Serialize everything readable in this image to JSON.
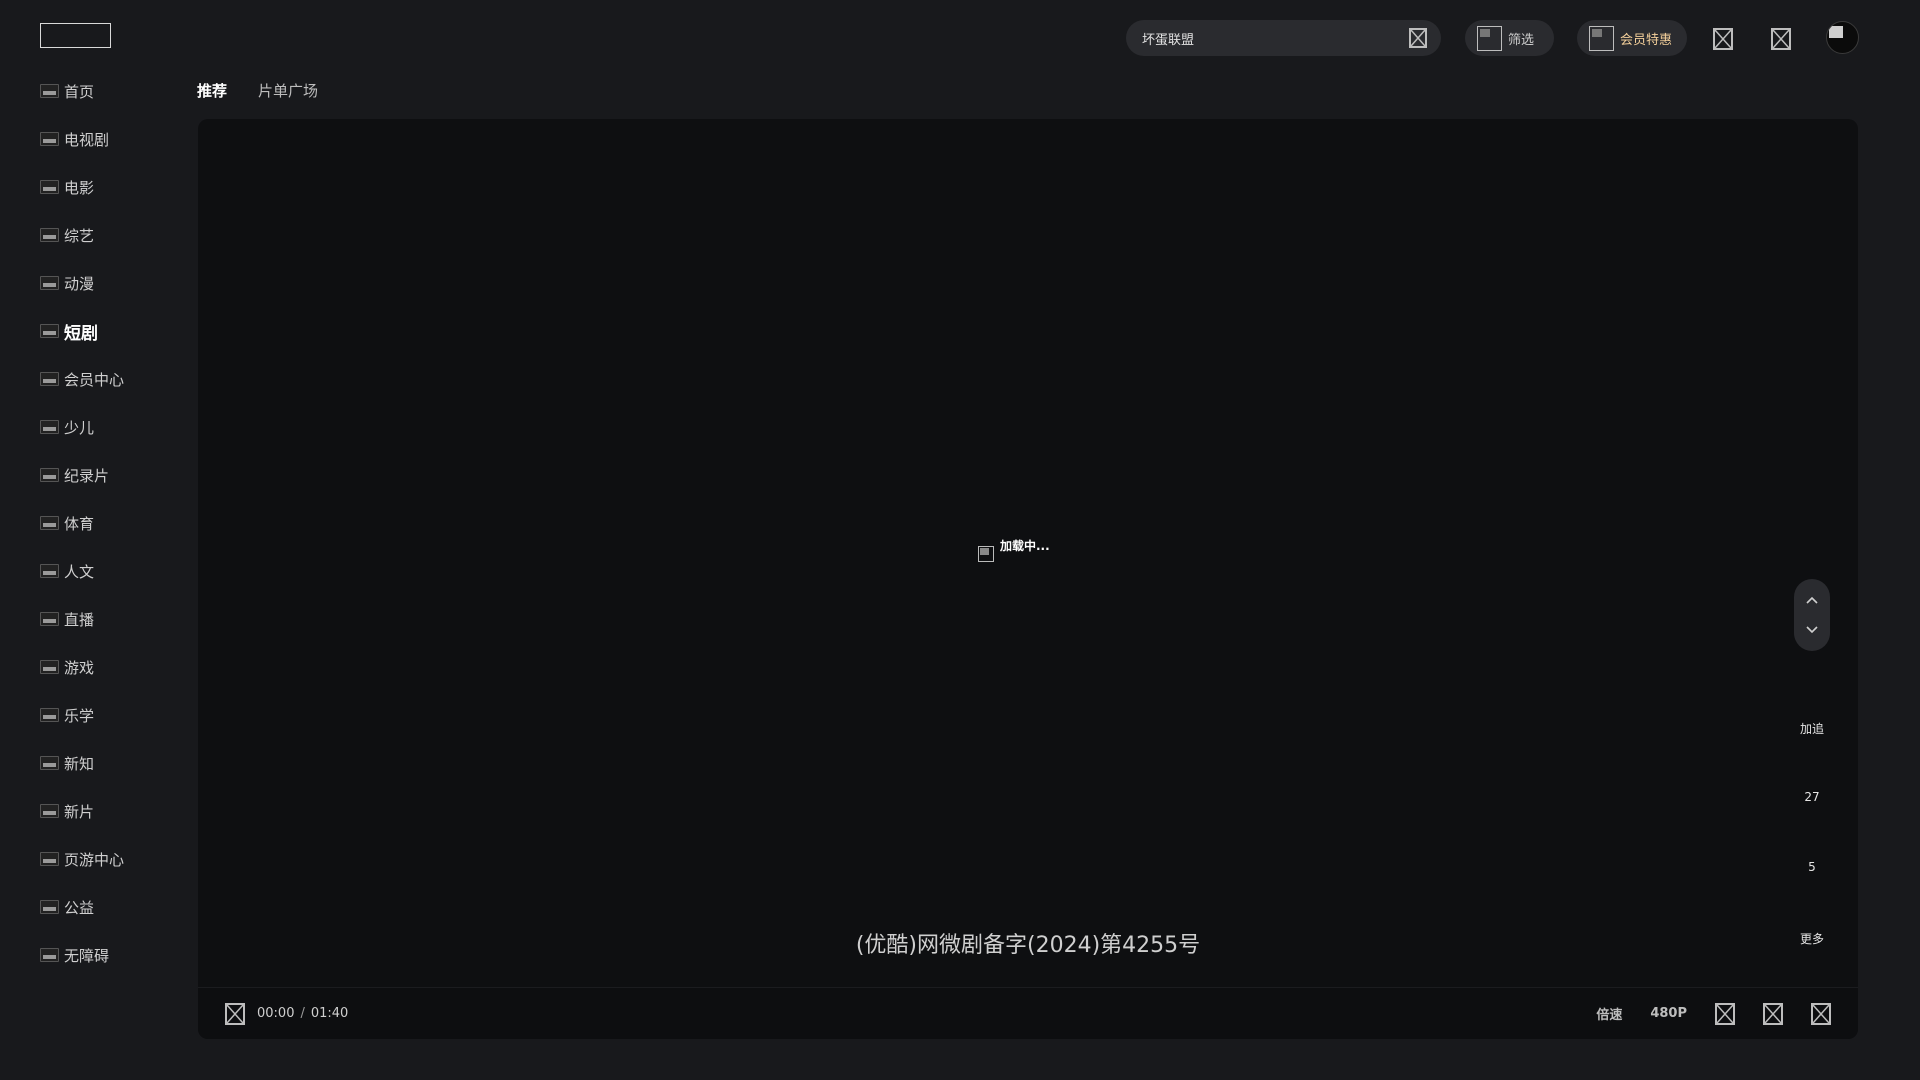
{
  "sidebar": {
    "items": [
      {
        "label": "首页"
      },
      {
        "label": "电视剧"
      },
      {
        "label": "电影"
      },
      {
        "label": "综艺"
      },
      {
        "label": "动漫"
      },
      {
        "label": "短剧",
        "active": true
      },
      {
        "label": "会员中心"
      },
      {
        "label": "少儿"
      },
      {
        "label": "纪录片"
      },
      {
        "label": "体育"
      },
      {
        "label": "人文"
      },
      {
        "label": "直播"
      },
      {
        "label": "游戏"
      },
      {
        "label": "乐学"
      },
      {
        "label": "新知"
      },
      {
        "label": "新片"
      },
      {
        "label": "页游中心"
      },
      {
        "label": "公益"
      },
      {
        "label": "无障碍"
      }
    ]
  },
  "header": {
    "search_value": "坏蛋联盟",
    "filter_label": "筛选",
    "vip_label": "会员特惠"
  },
  "tabs": [
    {
      "label": "推荐",
      "active": true
    },
    {
      "label": "片单广场"
    }
  ],
  "player": {
    "loading_text": "加载中...",
    "license_text": "(优酷)网微剧备字(2024)第4255号",
    "rail": {
      "follow_label": "加追",
      "count_a": "27",
      "count_b": "5",
      "more_label": "更多"
    },
    "controls": {
      "current_time": "00:00",
      "separator": "/",
      "total_time": "01:40",
      "speed_label": "倍速",
      "quality_label": "480P"
    }
  },
  "colors": {
    "background": "#18191c",
    "player_bg": "#0e0f11",
    "vip_accent": "#f3cf9a"
  }
}
